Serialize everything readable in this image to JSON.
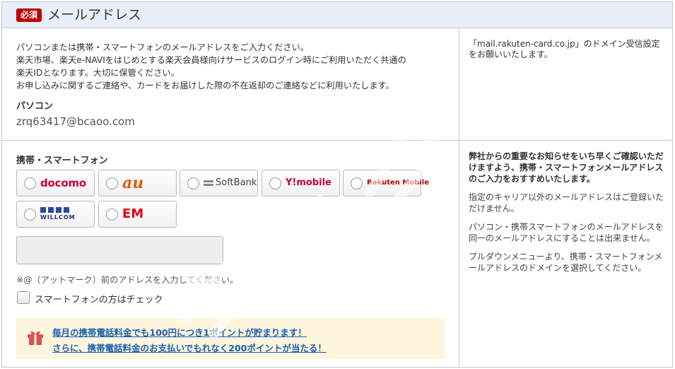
{
  "section": {
    "required_badge": "必須",
    "title": "メールアドレス"
  },
  "pc": {
    "intro_lines": [
      "パソコンまたは携帯・スマートフォンのメールアドレスをご入力ください。",
      "楽天市場、楽天e-NAVIをはじめとする楽天会員様向けサービスのログイン時にご利用いただく共通の",
      "楽天IDとなります。大切に保管ください。",
      "お申し込みに関するご連絡や、カードをお届けした際の不在返却のご連絡などに利用いたします。"
    ],
    "label": "パソコン",
    "email": "zrq63417@bcaoo.com",
    "side_note": "「mail.rakuten-card.co.jp」のドメイン受信設定をお願いいたします。"
  },
  "smartphone": {
    "label": "携帯・スマートフォン",
    "carriers": [
      "docomo",
      "au",
      "SoftBank",
      "Y!mobile",
      "Rakuten Mobile",
      "WILLCOM",
      "EM"
    ],
    "address_value": "",
    "note": "※@（アットマーク）前のアドレスを入力してください。",
    "checkbox_label": "スマートフォンの方はチェック",
    "checkbox_checked": false,
    "promo": {
      "line1": "毎月の携帯電話料金でも100円につき1ポイントが貯まります！",
      "line2": "さらに、携帯電話料金のお支払いでもれなく200ポイントが当たる！"
    },
    "side_notes": [
      "弊社からの重要なお知らせをいち早くご確認いただけますよう、携帯・スマートフォンメールアドレスのご入力をおすすめいたします。",
      "指定のキャリア以外のメールアドレスはご登録いただけません。",
      "パソコン・携帯スマートフォンのメールアドレスを同一のメールアドレスにすることは出来ません。",
      "プルダウンメニューより、携帯・スマートフォンメールアドレスのドメインを選択してください。"
    ]
  },
  "colors": {
    "header_bg": "#e9eff8",
    "badge_red": "#bf0000",
    "link_blue": "#1a5fb4",
    "promo_bg": "#fff4dc",
    "border": "#c8c8c8"
  },
  "icons": [
    "gift-icon",
    "radio-icon",
    "checkbox-icon"
  ]
}
